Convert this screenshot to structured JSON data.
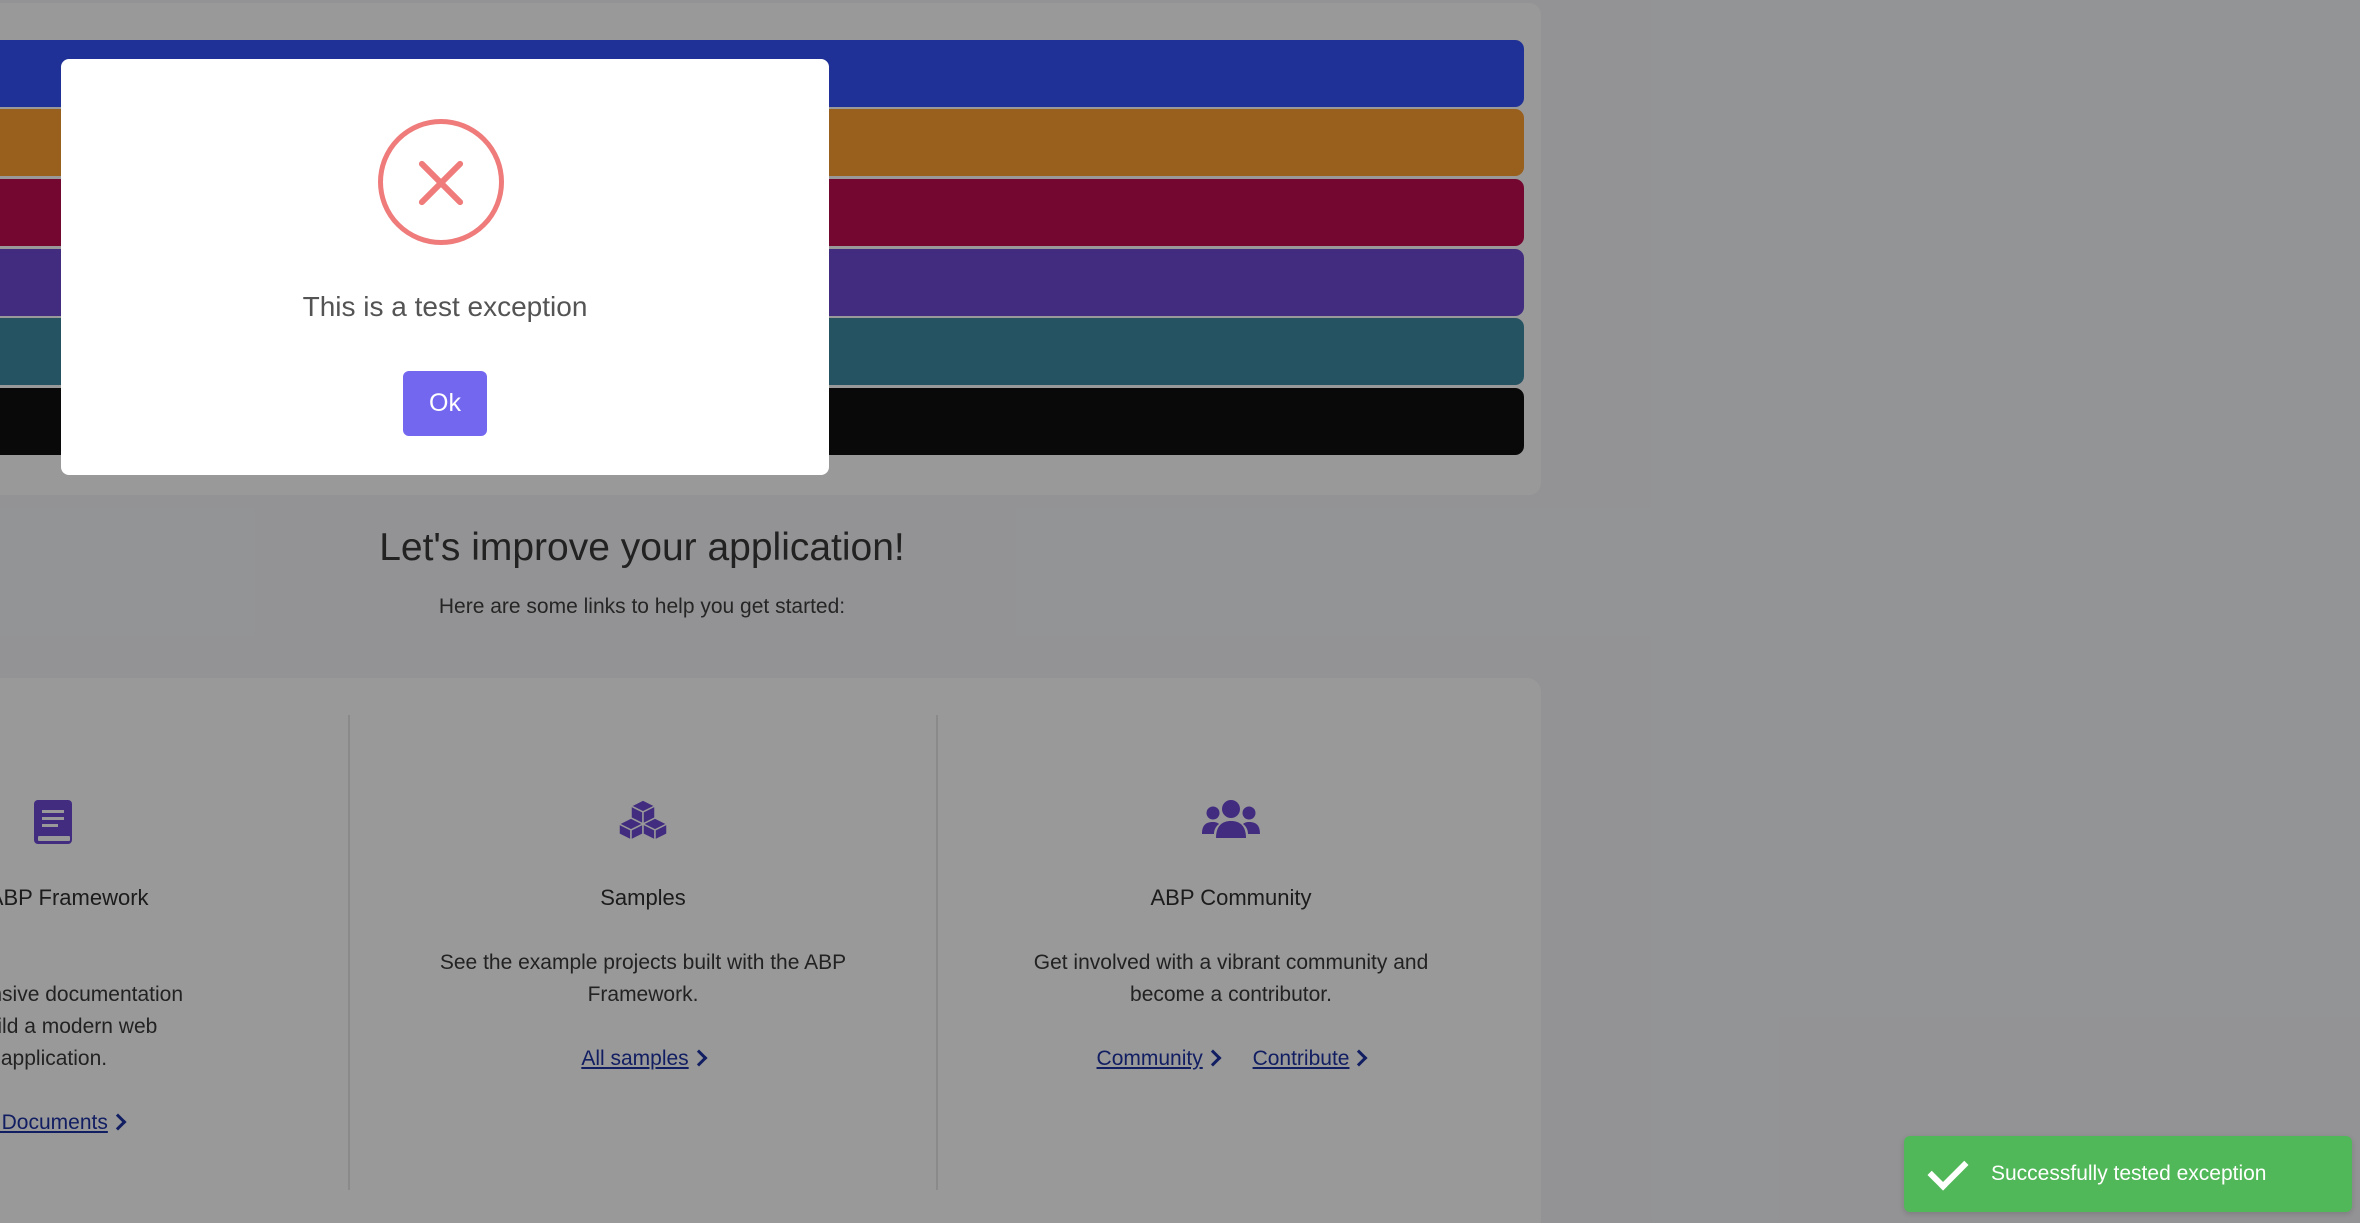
{
  "stripes": [
    {
      "color": "#3553fb"
    },
    {
      "color": "#ff9f2f"
    },
    {
      "color": "#c20c4f"
    },
    {
      "color": "#6e4ad5"
    },
    {
      "color": "#3f8aa4"
    },
    {
      "color": "#101010"
    }
  ],
  "improve": {
    "title": "Let's improve your application!",
    "subtitle": "Here are some links to help you get started:"
  },
  "features": [
    {
      "icon": "book-icon",
      "title": "he ABP Framework",
      "description": "nprehensive documentation\n to build a modern web\napplication.",
      "links": [
        {
          "label": "e Documents"
        }
      ]
    },
    {
      "icon": "cubes-icon",
      "title": "Samples",
      "description": "See the example projects built with the ABP Framework.",
      "links": [
        {
          "label": "All samples"
        }
      ]
    },
    {
      "icon": "users-icon",
      "title": "ABP Community",
      "description": "Get involved with a vibrant community and become a contributor.",
      "links": [
        {
          "label": "Community"
        },
        {
          "label": "Contribute"
        }
      ]
    }
  ],
  "modal": {
    "icon": "error-x-icon",
    "message": "This is a test exception",
    "ok_label": "Ok"
  },
  "toast": {
    "icon": "check-icon",
    "message": "Successfully tested exception"
  },
  "colors": {
    "accent": "#7367f0",
    "error": "#ef7b7b",
    "success": "#51b859",
    "link": "#1f32a4"
  }
}
